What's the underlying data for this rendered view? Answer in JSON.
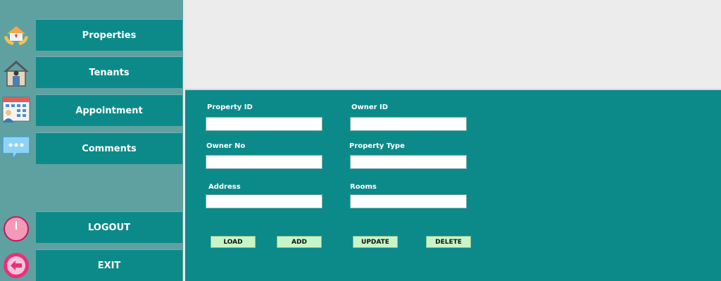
{
  "sidebar": {
    "items": [
      {
        "label": "Properties",
        "icon": "house-hands-icon"
      },
      {
        "label": "Tenants",
        "icon": "house-person-icon"
      },
      {
        "label": "Appointment",
        "icon": "calendar-person-icon"
      },
      {
        "label": "Comments",
        "icon": "chat-bubble-icon"
      }
    ],
    "logout": {
      "label": "LOGOUT",
      "icon": "power-icon"
    },
    "exit": {
      "label": "EXIT",
      "icon": "exit-arrow-icon"
    }
  },
  "form": {
    "property_id": {
      "label": "Property ID",
      "value": ""
    },
    "owner_id": {
      "label": "Owner ID",
      "value": ""
    },
    "owner_no": {
      "label": "Owner No",
      "value": ""
    },
    "property_type": {
      "label": "Property Type",
      "value": ""
    },
    "address": {
      "label": "Address",
      "value": ""
    },
    "rooms": {
      "label": "Rooms",
      "value": ""
    }
  },
  "actions": {
    "load": "LOAD",
    "add": "ADD",
    "update": "UPDATE",
    "delete": "DELETE"
  },
  "colors": {
    "teal": "#0c8a8a",
    "sidebar": "#5fa1a1",
    "button_green": "#c8f5c8"
  }
}
